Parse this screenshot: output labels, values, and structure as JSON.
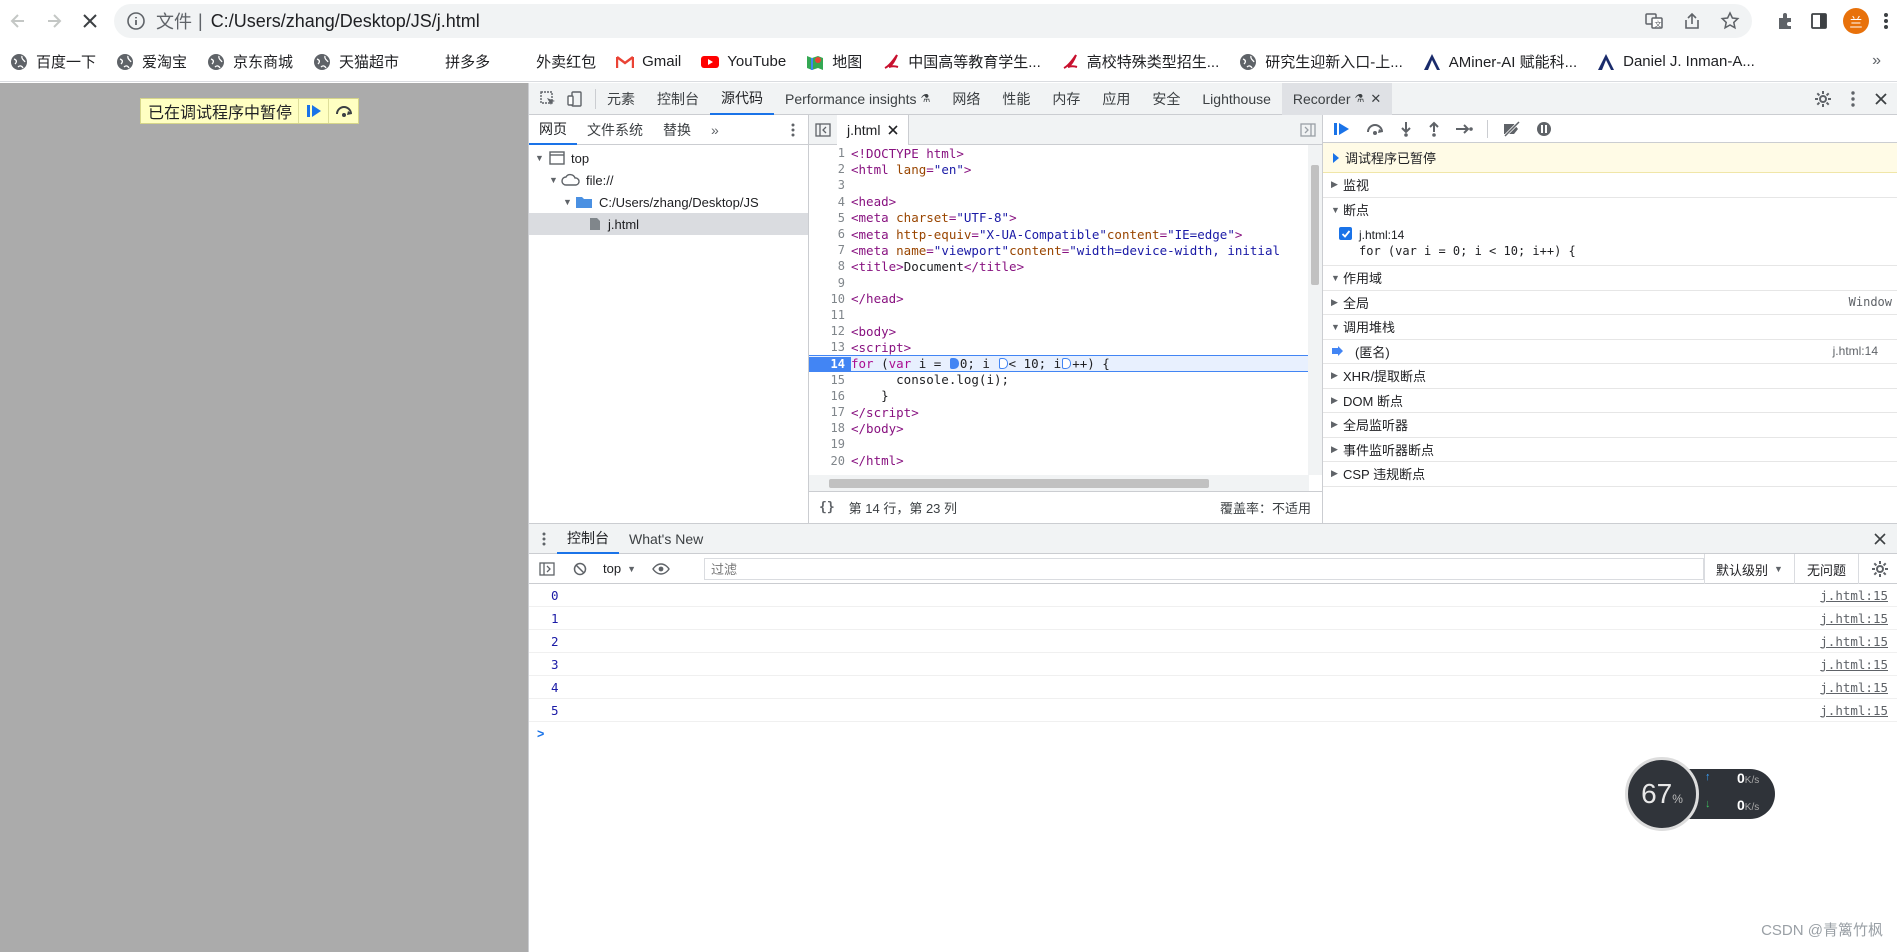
{
  "browser": {
    "scheme_label": "文件",
    "url": "C:/Users/zhang/Desktop/JS/j.html",
    "profile_initial": "兰",
    "bookmarks": [
      {
        "label": "百度一下",
        "icon": "globe-icon"
      },
      {
        "label": "爱淘宝",
        "icon": "globe-icon"
      },
      {
        "label": "京东商城",
        "icon": "globe-icon"
      },
      {
        "label": "天猫超市",
        "icon": "globe-icon"
      },
      {
        "label": "拼多多",
        "icon": ""
      },
      {
        "label": "外卖红包",
        "icon": ""
      },
      {
        "label": "Gmail",
        "icon": "gmail-icon"
      },
      {
        "label": "YouTube",
        "icon": "youtube-icon"
      },
      {
        "label": "地图",
        "icon": "maps-icon"
      },
      {
        "label": "中国高等教育学生...",
        "icon": "chsi-icon"
      },
      {
        "label": "高校特殊类型招生...",
        "icon": "chsi-icon"
      },
      {
        "label": "研究生迎新入口-上...",
        "icon": "globe-icon"
      },
      {
        "label": "AMiner-AI 赋能科...",
        "icon": "aminer-icon"
      },
      {
        "label": "Daniel J. Inman-A...",
        "icon": "aminer-icon"
      }
    ],
    "bookmarks_more": "»"
  },
  "page": {
    "paused_banner": "已在调试程序中暂停"
  },
  "devtools": {
    "tabs": [
      "元素",
      "控制台",
      "源代码",
      "Performance insights",
      "网络",
      "性能",
      "内存",
      "应用",
      "安全",
      "Lighthouse",
      "Recorder"
    ],
    "active_tab": "源代码",
    "nav_tabs": [
      "网页",
      "文件系统",
      "替换"
    ],
    "nav_more": "»",
    "tree": {
      "top": "top",
      "origin": "file://",
      "folder": "C:/Users/zhang/Desktop/JS",
      "file": "j.html"
    },
    "editor": {
      "file_tab": "j.html",
      "status_position": "第 14 行，第 23 列",
      "coverage": "覆盖率：不适用",
      "current_line": 14
    },
    "debugger": {
      "paused_label": "调试程序已暂停",
      "sections": {
        "watch": "监视",
        "breakpoints": "断点",
        "scope": "作用域",
        "call_stack": "调用堆栈",
        "xhr": "XHR/提取断点",
        "dom": "DOM 断点",
        "global_listeners": "全局监听器",
        "event_listeners": "事件监听器断点",
        "csp": "CSP 违规断点"
      },
      "breakpoint_file": "j.html:14",
      "breakpoint_code": "for (var i = 0; i < 10; i++) {",
      "scope_global": "全局",
      "scope_global_value": "Window",
      "frame_name": "(匿名)",
      "frame_location": "j.html:14"
    },
    "drawer": {
      "tabs": [
        "控制台",
        "What's New"
      ],
      "context": "top",
      "filter_placeholder": "过滤",
      "level": "默认级别",
      "issues": "无问题",
      "prompt": ">",
      "logs": [
        {
          "value": "0",
          "source": "j.html:15"
        },
        {
          "value": "1",
          "source": "j.html:15"
        },
        {
          "value": "2",
          "source": "j.html:15"
        },
        {
          "value": "3",
          "source": "j.html:15"
        },
        {
          "value": "4",
          "source": "j.html:15"
        },
        {
          "value": "5",
          "source": "j.html:15"
        }
      ]
    }
  },
  "speed_widget": {
    "percent": "67",
    "percent_sign": "%",
    "upload": "0",
    "download": "0",
    "unit": "K/s"
  },
  "watermark": "CSDN @青篱竹枫",
  "colors": {
    "accent": "#1a73e8",
    "breakpoint": "#4285f4",
    "paused_bg": "#ffffc2",
    "page_gray": "#ababab"
  }
}
